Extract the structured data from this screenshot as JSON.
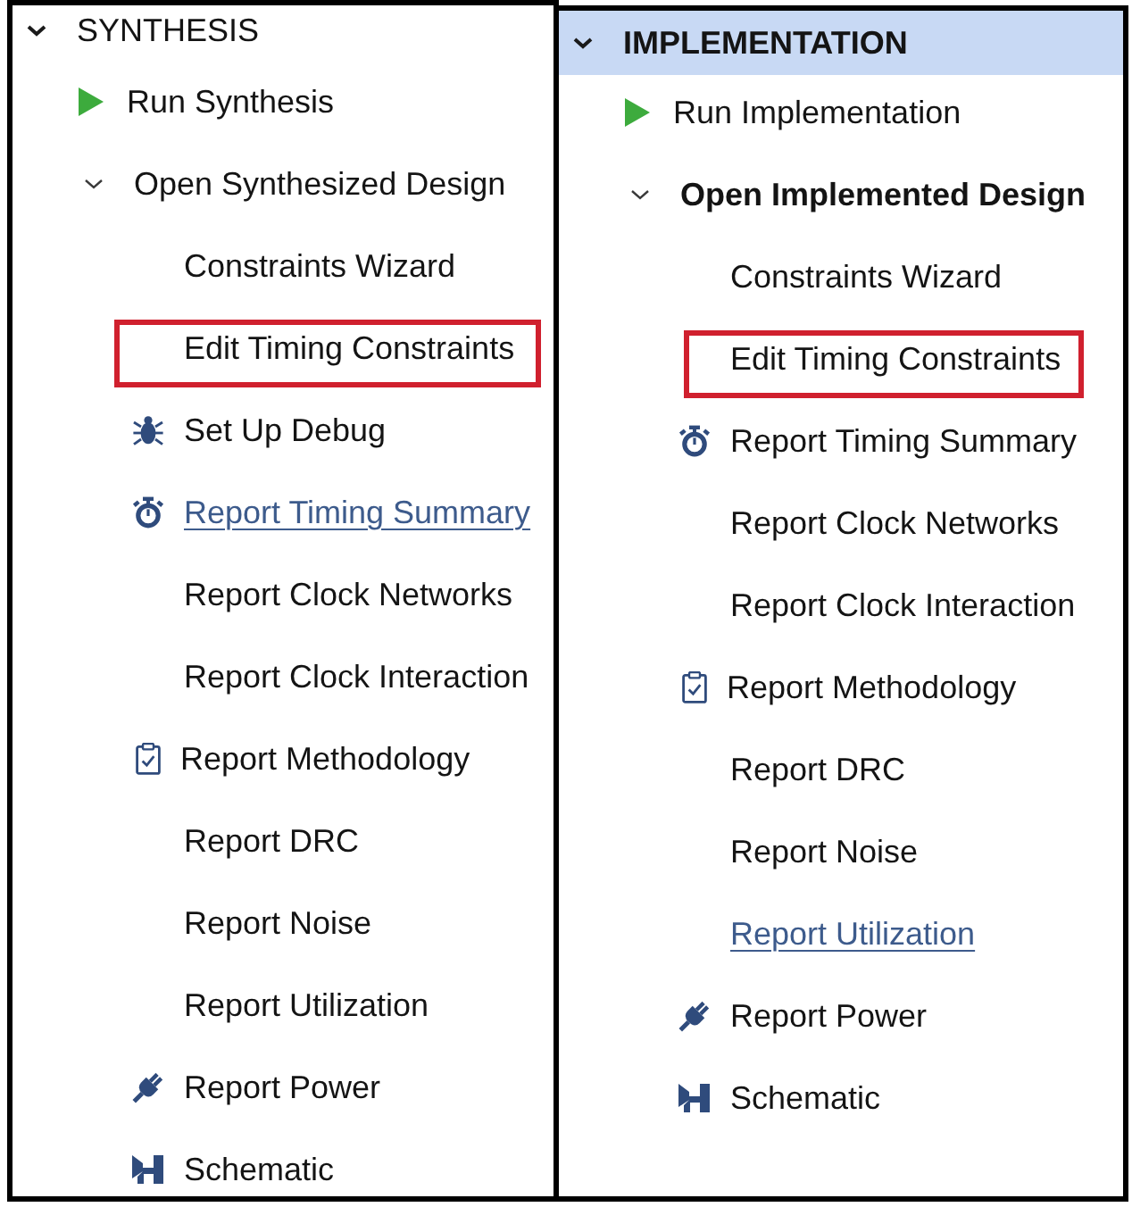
{
  "panels": [
    {
      "title": "SYNTHESIS",
      "selected": false,
      "expanded": true,
      "run": {
        "label": "Run Synthesis"
      },
      "design": {
        "label": "Open Synthesized Design",
        "active": false,
        "expanded": true,
        "children": [
          {
            "kind": "plain",
            "label": "Constraints Wizard",
            "hovered": false,
            "highlighted": false
          },
          {
            "kind": "plain",
            "label": "Edit Timing Constraints",
            "hovered": false,
            "highlighted": true
          },
          {
            "kind": "debug",
            "label": "Set Up Debug",
            "hovered": false,
            "highlighted": false
          },
          {
            "kind": "timing",
            "label": "Report Timing Summary",
            "hovered": true,
            "highlighted": false
          },
          {
            "kind": "plain",
            "label": "Report Clock Networks",
            "hovered": false,
            "highlighted": false
          },
          {
            "kind": "plain",
            "label": "Report Clock Interaction",
            "hovered": false,
            "highlighted": false
          },
          {
            "kind": "methodology",
            "label": "Report Methodology",
            "hovered": false,
            "highlighted": false
          },
          {
            "kind": "plain",
            "label": "Report DRC",
            "hovered": false,
            "highlighted": false
          },
          {
            "kind": "plain",
            "label": "Report Noise",
            "hovered": false,
            "highlighted": false
          },
          {
            "kind": "plain",
            "label": "Report Utilization",
            "hovered": false,
            "highlighted": false
          },
          {
            "kind": "power",
            "label": "Report Power",
            "hovered": false,
            "highlighted": false
          },
          {
            "kind": "schematic",
            "label": "Schematic",
            "hovered": false,
            "highlighted": false
          }
        ]
      }
    },
    {
      "title": "IMPLEMENTATION",
      "selected": true,
      "expanded": true,
      "run": {
        "label": "Run Implementation"
      },
      "design": {
        "label": "Open Implemented Design",
        "active": true,
        "expanded": true,
        "children": [
          {
            "kind": "plain",
            "label": "Constraints Wizard",
            "hovered": false,
            "highlighted": false
          },
          {
            "kind": "plain",
            "label": "Edit Timing Constraints",
            "hovered": false,
            "highlighted": true
          },
          {
            "kind": "timing",
            "label": "Report Timing Summary",
            "hovered": false,
            "highlighted": false
          },
          {
            "kind": "plain",
            "label": "Report Clock Networks",
            "hovered": false,
            "highlighted": false
          },
          {
            "kind": "plain",
            "label": "Report Clock Interaction",
            "hovered": false,
            "highlighted": false
          },
          {
            "kind": "methodology",
            "label": "Report Methodology",
            "hovered": false,
            "highlighted": false
          },
          {
            "kind": "plain",
            "label": "Report DRC",
            "hovered": false,
            "highlighted": false
          },
          {
            "kind": "plain",
            "label": "Report Noise",
            "hovered": false,
            "highlighted": false
          },
          {
            "kind": "plain",
            "label": "Report Utilization",
            "hovered": true,
            "highlighted": false
          },
          {
            "kind": "power",
            "label": "Report Power",
            "hovered": false,
            "highlighted": false
          },
          {
            "kind": "schematic",
            "label": "Schematic",
            "hovered": false,
            "highlighted": false
          }
        ]
      }
    }
  ]
}
